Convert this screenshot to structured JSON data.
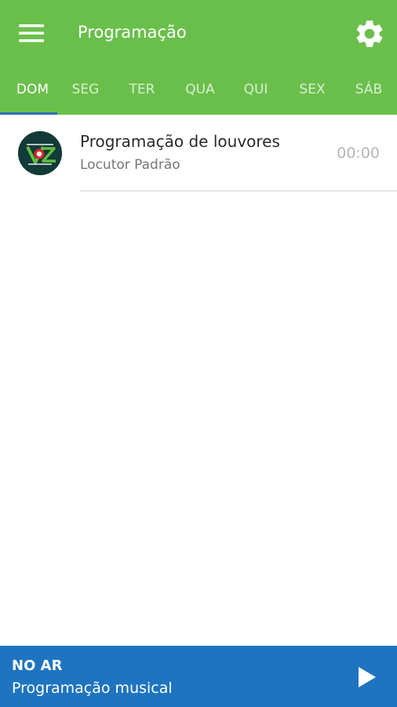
{
  "header": {
    "title": "Programação",
    "menu_icon": "hamburger-menu-icon",
    "settings_icon": "gear-icon",
    "background_color": "#6abf4b"
  },
  "tabs": [
    {
      "label": "DOM",
      "active": true
    },
    {
      "label": "SEG",
      "active": false
    },
    {
      "label": "TER",
      "active": false
    },
    {
      "label": "QUA",
      "active": false
    },
    {
      "label": "QUI",
      "active": false
    },
    {
      "label": "SEX",
      "active": false
    },
    {
      "label": "SÁB",
      "active": false
    }
  ],
  "schedule": [
    {
      "title": "Programação de louvores",
      "host": "Locutor Padrão",
      "time": "00:00",
      "avatar_icon": "station-logo-icon"
    }
  ],
  "player": {
    "status_label": "NO AR",
    "program": "Programação musical",
    "play_icon": "play-icon",
    "background_color": "#1e74bf"
  },
  "colors": {
    "tab_indicator": "#2a6fb8"
  }
}
